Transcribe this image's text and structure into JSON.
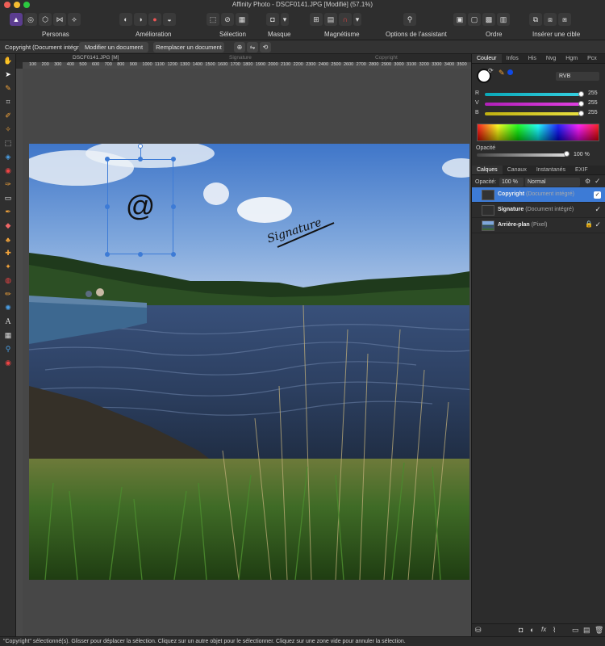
{
  "window": {
    "title": "Affinity Photo - DSCF0141.JPG [Modifié] (57.1%)"
  },
  "toolbar": {
    "personas_label": "Personas",
    "enhance_label": "Amélioration",
    "selection_label": "Sélection",
    "mask_label": "Masque",
    "snapping_label": "Magnétisme",
    "assistant_label": "Options de l'assistant",
    "order_label": "Ordre",
    "insert_target_label": "Insérer une cible"
  },
  "context": {
    "selection_text": "Copyright (Document intégré)",
    "edit_button": "Modifier un document",
    "replace_button": "Remplacer un document"
  },
  "document": {
    "tab_name": "DSCF0141.JPG [M]",
    "guide_signature": "Signature",
    "guide_copyright": "Copyright"
  },
  "ruler": {
    "ticks": [
      "100",
      "200",
      "300",
      "400",
      "500",
      "600",
      "700",
      "800",
      "900",
      "1000",
      "1100",
      "1200",
      "1300",
      "1400",
      "1500",
      "1600",
      "1700",
      "1800",
      "1900",
      "2000",
      "2100",
      "2200",
      "2300",
      "2400",
      "2500",
      "2600",
      "2700",
      "2800",
      "2900",
      "3000",
      "3100",
      "3200",
      "3300",
      "3400",
      "3500"
    ]
  },
  "canvas": {
    "copyright_glyph": "@",
    "signature_text": "Signature"
  },
  "panel": {
    "tabs": [
      "Couleur",
      "Infos",
      "His",
      "Nvg",
      "Hgm",
      "Pcx"
    ],
    "color_mode": "RVB",
    "channels": [
      {
        "label": "R",
        "value": "255",
        "color": "#35d0e0"
      },
      {
        "label": "V",
        "value": "255",
        "color": "#e040e0"
      },
      {
        "label": "B",
        "value": "255",
        "color": "#e8e040"
      }
    ],
    "opacity_label": "Opacité",
    "opacity_value": "100 %",
    "layers_tabs": [
      "Calques",
      "Canaux",
      "Instantanés",
      "EXIF"
    ],
    "layers_opacity_label": "Opacité:",
    "layers_opacity_value": "100 %",
    "blend_mode": "Normal",
    "layers": [
      {
        "name": "Copyright",
        "type": "(Document intégré)",
        "selected": true
      },
      {
        "name": "Signature",
        "type": "(Document intégré)",
        "selected": false
      },
      {
        "name": "Arrière-plan",
        "type": "(Pixel)",
        "selected": false
      }
    ]
  },
  "status": {
    "message": "\"Copyright\" sélectionné(s). Glisser pour déplacer la sélection. Cliquez sur un autre objet pour le sélectionner. Cliquez sur une zone vide pour annuler la sélection."
  },
  "colors": {
    "accent": "#3d7bd6",
    "panel_bg": "#2c2c2c",
    "canvas_bg": "#474747",
    "fill_swatch": "#ffffff",
    "stroke_swatch": "#0f49e6"
  }
}
